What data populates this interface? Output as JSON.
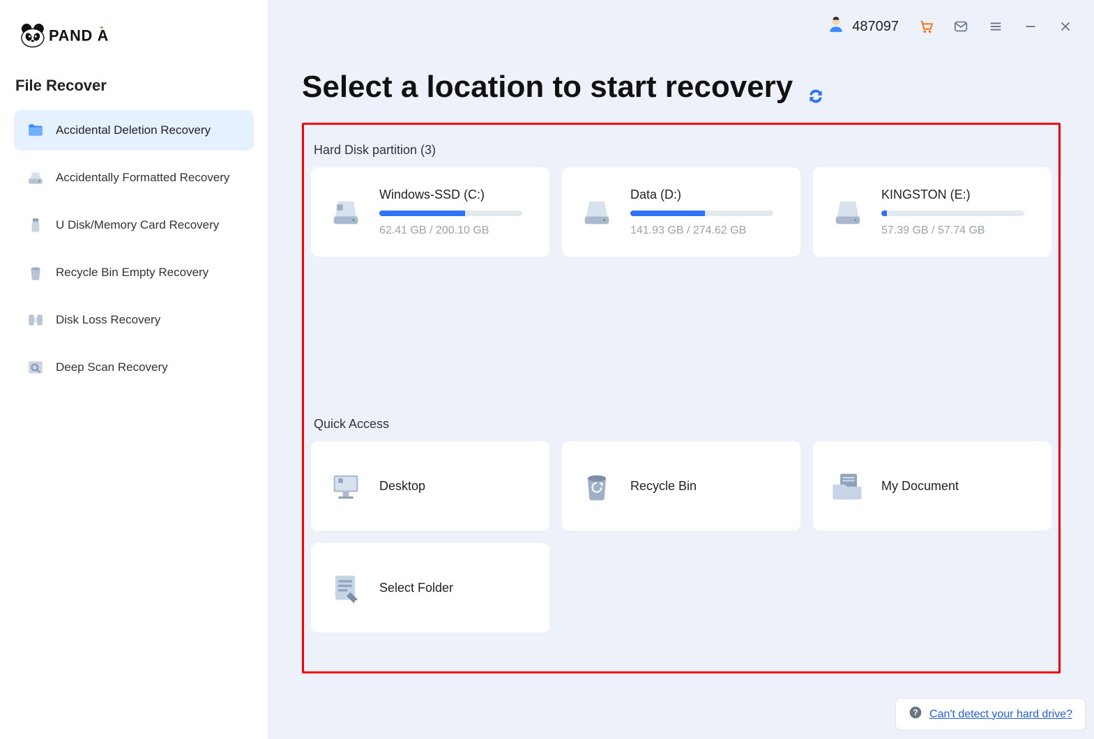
{
  "brand": "PANDA",
  "titlebar": {
    "user_id": "487097"
  },
  "sidebar": {
    "title": "File Recover",
    "items": [
      {
        "label": "Accidental Deletion Recovery"
      },
      {
        "label": "Accidentally Formatted Recovery"
      },
      {
        "label": "U Disk/Memory Card Recovery"
      },
      {
        "label": "Recycle Bin Empty Recovery"
      },
      {
        "label": "Disk Loss Recovery"
      },
      {
        "label": "Deep Scan Recovery"
      }
    ]
  },
  "page": {
    "title": "Select a location to start recovery",
    "partition_label": "Hard Disk partition   (3)",
    "quick_access_label": "Quick Access"
  },
  "drives": [
    {
      "name": "Windows-SSD   (C:)",
      "used": "62.41 GB",
      "total": "200.10 GB",
      "pct": 60
    },
    {
      "name": "Data   (D:)",
      "used": "141.93 GB",
      "total": "274.62 GB",
      "pct": 52
    },
    {
      "name": "KINGSTON   (E:)",
      "used": "57.39 GB",
      "total": "57.74 GB",
      "pct": 4
    }
  ],
  "quick": [
    {
      "label": "Desktop"
    },
    {
      "label": "Recycle Bin"
    },
    {
      "label": "My Document"
    },
    {
      "label": "Select Folder"
    }
  ],
  "help": {
    "text": "Can't detect your hard drive?"
  }
}
